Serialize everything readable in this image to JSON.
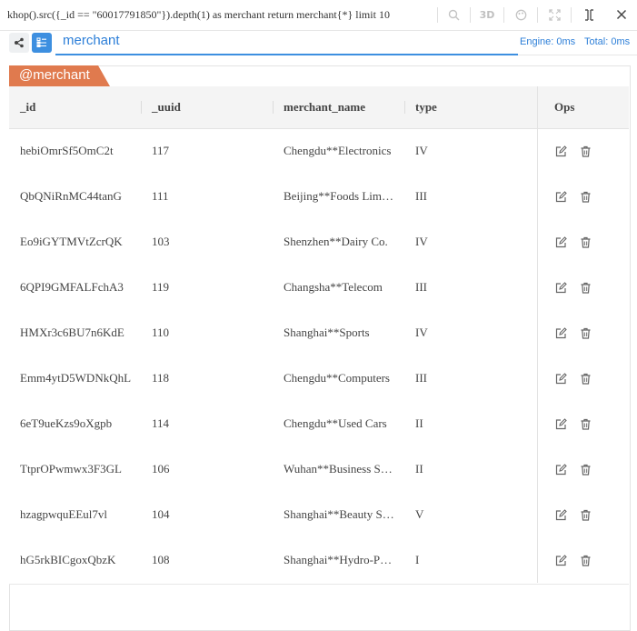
{
  "query": "khop().src({_id == \"60017791850\"}).depth(1) as merchant return merchant{*} limit 10",
  "toolbar": {
    "search_icon": "search-icon",
    "view3d_label": "3D",
    "palette_icon": "palette-icon",
    "fullscreen_icon": "expand-icon",
    "split_icon": "split-icon",
    "close_icon": "close-icon"
  },
  "tab": {
    "label": "merchant"
  },
  "stats": {
    "engine": "Engine: 0ms",
    "total": "Total: 0ms"
  },
  "result": {
    "alias": "@merchant",
    "columns": [
      "_id",
      "_uuid",
      "merchant_name",
      "type",
      "Ops"
    ],
    "rows": [
      {
        "id": "hebiOmrSf5OmC2t",
        "uuid": "117",
        "name": "Chengdu**Electronics",
        "type": "IV"
      },
      {
        "id": "QbQNiRnMC44tanG",
        "uuid": "111",
        "name": "Beijing**Foods Limited",
        "type": "III"
      },
      {
        "id": "Eo9iGYTMVtZcrQK",
        "uuid": "103",
        "name": "Shenzhen**Dairy Co.",
        "type": "IV"
      },
      {
        "id": "6QPI9GMFALFchA3",
        "uuid": "119",
        "name": "Changsha**Telecom",
        "type": "III"
      },
      {
        "id": "HMXr3c6BU7n6KdE",
        "uuid": "110",
        "name": "Shanghai**Sports",
        "type": "IV"
      },
      {
        "id": "Emm4ytD5WDNkQhL",
        "uuid": "118",
        "name": "Chengdu**Computers",
        "type": "III"
      },
      {
        "id": "6eT9ueKzs9oXgpb",
        "uuid": "114",
        "name": "Chengdu**Used Cars",
        "type": "II"
      },
      {
        "id": "TtprOPwmwx3F3GL",
        "uuid": "106",
        "name": "Wuhan**Business Services",
        "type": "II"
      },
      {
        "id": "hzagpwquEEul7vl",
        "uuid": "104",
        "name": "Shanghai**Beauty Salon",
        "type": "V"
      },
      {
        "id": "hG5rkBICgoxQbzK",
        "uuid": "108",
        "name": "Shanghai**Hydro-Power",
        "type": "I"
      }
    ]
  },
  "colors": {
    "accent": "#3d8fe0",
    "badge": "#e07a4e"
  }
}
